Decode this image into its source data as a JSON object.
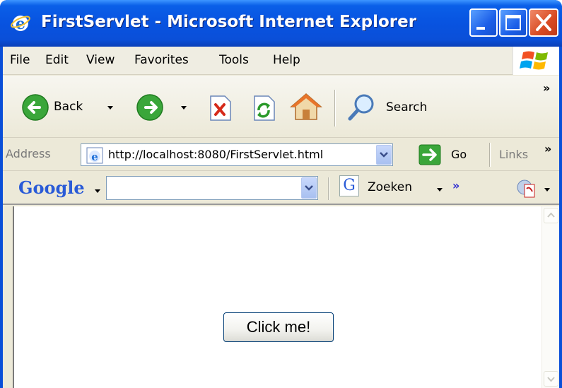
{
  "window": {
    "title": "FirstServlet - Microsoft Internet Explorer"
  },
  "menu": {
    "items": [
      {
        "label": "File"
      },
      {
        "label": "Edit"
      },
      {
        "label": "View"
      },
      {
        "label": "Favorites"
      },
      {
        "label": "Tools"
      },
      {
        "label": "Help"
      }
    ]
  },
  "toolbar": {
    "back_label": "Back",
    "search_label": "Search",
    "more": "»"
  },
  "address": {
    "label": "Address",
    "url": "http://localhost:8080/FirstServlet.html",
    "go_label": "Go",
    "links_label": "Links",
    "links_more": "»"
  },
  "google": {
    "logo": "Google",
    "search_value": "",
    "zoeken_label": "Zoeken",
    "more": "»"
  },
  "page": {
    "button_label": "Click me!"
  },
  "colors": {
    "titlebar": "#0a4fd8",
    "chrome": "#ece9d8",
    "button_border": "#003c74"
  }
}
